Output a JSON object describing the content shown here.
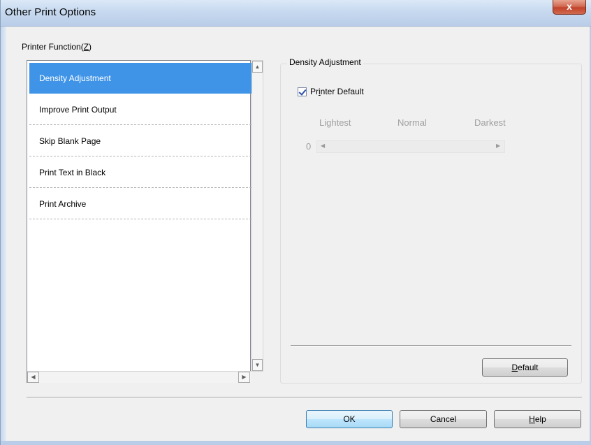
{
  "window": {
    "title": "Other Print Options",
    "close_glyph": "x"
  },
  "printer_function": {
    "label": "Printer Function(Z)",
    "items": [
      {
        "label": "Density Adjustment",
        "selected": true
      },
      {
        "label": "Improve Print Output",
        "selected": false
      },
      {
        "label": "Skip Blank Page",
        "selected": false
      },
      {
        "label": "Print Text in Black",
        "selected": false
      },
      {
        "label": "Print Archive",
        "selected": false
      }
    ]
  },
  "density": {
    "group_title": "Density Adjustment",
    "printer_default_label": "Printer Default",
    "printer_default_checked": true,
    "scale_lightest": "Lightest",
    "scale_normal": "Normal",
    "scale_darkest": "Darkest",
    "value": "0",
    "default_button": "Default"
  },
  "buttons": {
    "ok": "OK",
    "cancel": "Cancel",
    "help": "Help"
  },
  "colors": {
    "selection": "#3f94e8",
    "titlebar": "#c7d9ef",
    "close": "#c1432a"
  }
}
